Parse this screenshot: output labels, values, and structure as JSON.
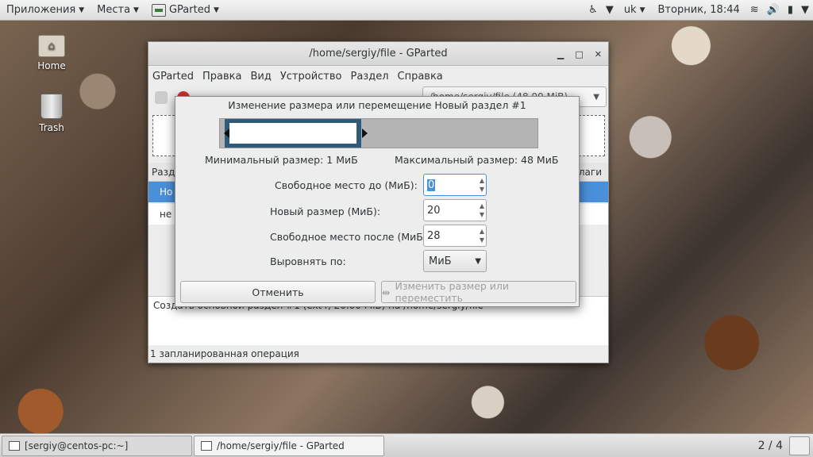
{
  "top_panel": {
    "applications": "Приложения",
    "places": "Места",
    "active_app": "GParted",
    "layout": "uk",
    "clock": "Вторник, 18:44"
  },
  "desktop": {
    "home_label": "Home",
    "trash_label": "Trash"
  },
  "main_window": {
    "title": "/home/sergiy/file - GParted",
    "menu": [
      "GParted",
      "Правка",
      "Вид",
      "Устройство",
      "Раздел",
      "Справка"
    ],
    "device_selector": "/home/sergiy/file (48.00 MiB)",
    "table_header_left": "Разд",
    "table_header_right": "лаги",
    "row_selected": "Но",
    "row_2": "не",
    "pending_op": "Создать основной раздел #1 (ext4, 20.00 MiB) на /home/sergiy/file",
    "status": "1 запланированная операция"
  },
  "dialog": {
    "title": "Изменение размера или перемещение Новый раздел #1",
    "min_size": "Минимальный размер: 1 МиБ",
    "max_size": "Максимальный размер: 48 МиБ",
    "free_before_label": "Свободное место до (МиБ):",
    "free_before_value": "0",
    "new_size_label": "Новый размер (МиБ):",
    "new_size_value": "20",
    "free_after_label": "Свободное место после (МиБ):",
    "free_after_value": "28",
    "align_label": "Выровнять по:",
    "align_value": "МиБ",
    "cancel_label": "Отменить",
    "resize_label": "Изменить размер или переместить"
  },
  "taskbar": {
    "terminal_task": "[sergiy@centos-pc:~]",
    "gparted_task": "/home/sergiy/file - GParted",
    "workspace": "2 / 4"
  }
}
